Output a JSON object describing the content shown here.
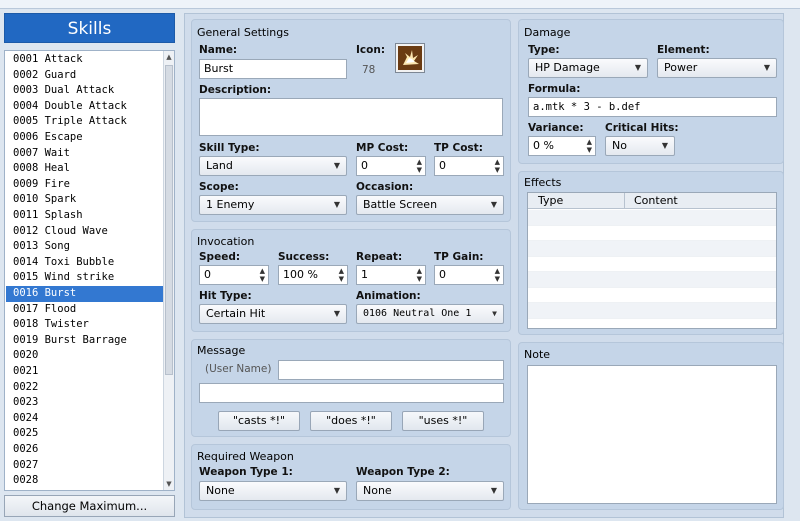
{
  "skills_title": "Skills",
  "skills": [
    "0001 Attack",
    "0002 Guard",
    "0003 Dual Attack",
    "0004 Double Attack",
    "0005 Triple Attack",
    "0006 Escape",
    "0007 Wait",
    "0008 Heal",
    "0009 Fire",
    "0010 Spark",
    "0011 Splash",
    "0012 Cloud Wave",
    "0013 Song",
    "0014 Toxi Bubble",
    "0015 Wind strike",
    "0016 Burst",
    "0017 Flood",
    "0018 Twister",
    "0019 Burst Barrage",
    "0020",
    "0021",
    "0022",
    "0023",
    "0024",
    "0025",
    "0026",
    "0027",
    "0028"
  ],
  "selected_skill": "0016 Burst",
  "change_max_label": "Change Maximum...",
  "general": {
    "title": "General Settings",
    "name_label": "Name:",
    "name_value": "Burst",
    "icon_label": "Icon:",
    "icon_index": "78",
    "desc_label": "Description:",
    "desc_value": "",
    "skill_type_label": "Skill Type:",
    "skill_type_value": "Land",
    "mp_cost_label": "MP Cost:",
    "mp_cost_value": "0",
    "tp_cost_label": "TP Cost:",
    "tp_cost_value": "0",
    "scope_label": "Scope:",
    "scope_value": "1 Enemy",
    "occasion_label": "Occasion:",
    "occasion_value": "Battle Screen"
  },
  "invocation": {
    "title": "Invocation",
    "speed_label": "Speed:",
    "speed_value": "0",
    "success_label": "Success:",
    "success_value": "100 %",
    "repeat_label": "Repeat:",
    "repeat_value": "1",
    "tp_gain_label": "TP Gain:",
    "tp_gain_value": "0",
    "hit_type_label": "Hit Type:",
    "hit_type_value": "Certain Hit",
    "animation_label": "Animation:",
    "animation_value": "0106 Neutral One 1"
  },
  "message": {
    "title": "Message",
    "user_name_placeholder": "(User Name)",
    "line1": "",
    "line2": "",
    "btn_casts": "\"casts *!\"",
    "btn_does": "\"does *!\"",
    "btn_uses": "\"uses *!\""
  },
  "weapon": {
    "title": "Required Weapon",
    "type1_label": "Weapon Type 1:",
    "type1_value": "None",
    "type2_label": "Weapon Type 2:",
    "type2_value": "None"
  },
  "damage": {
    "title": "Damage",
    "type_label": "Type:",
    "type_value": "HP Damage",
    "element_label": "Element:",
    "element_value": "Power",
    "formula_label": "Formula:",
    "formula_value": "a.mtk * 3 - b.def",
    "variance_label": "Variance:",
    "variance_value": "0 %",
    "critical_label": "Critical Hits:",
    "critical_value": "No"
  },
  "effects": {
    "title": "Effects",
    "col_type": "Type",
    "col_content": "Content"
  },
  "note": {
    "title": "Note"
  },
  "colors": {
    "selection": "#3378d1",
    "header": "#2168c2",
    "panel": "#c5d5e8"
  }
}
